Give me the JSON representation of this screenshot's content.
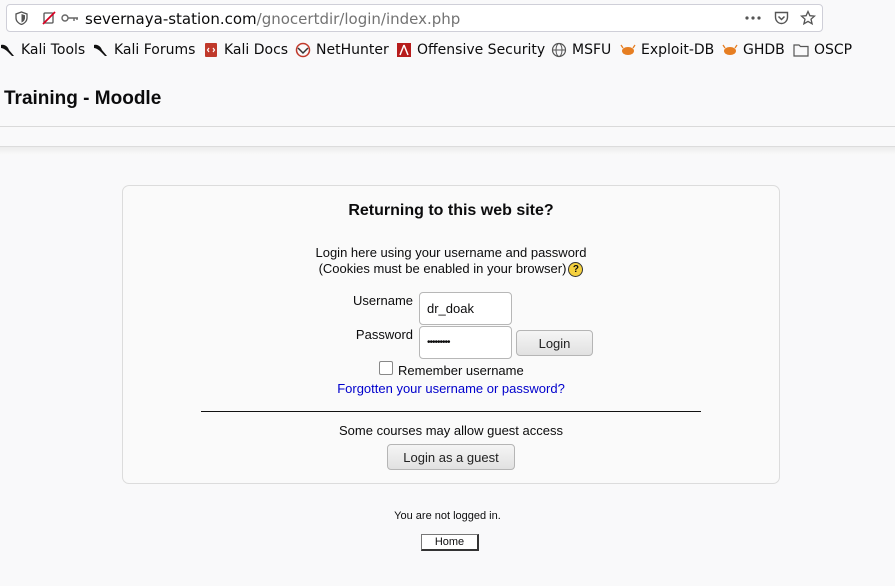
{
  "browser": {
    "url_domain": "severnaya-station.com",
    "url_path": "/gnocertdir/login/index.php"
  },
  "bookmarks": [
    {
      "label": "Kali Tools",
      "icon": "kali-dragon-icon"
    },
    {
      "label": "Kali Forums",
      "icon": "kali-dragon-icon"
    },
    {
      "label": "Kali Docs",
      "icon": "docs-book-icon"
    },
    {
      "label": "NetHunter",
      "icon": "nethunter-icon"
    },
    {
      "label": "Offensive Security",
      "icon": "offsec-icon"
    },
    {
      "label": "MSFU",
      "icon": "globe-icon"
    },
    {
      "label": "Exploit-DB",
      "icon": "exploitdb-bug-icon"
    },
    {
      "label": "GHDB",
      "icon": "exploitdb-bug-icon"
    },
    {
      "label": "OSCP",
      "icon": "folder-icon"
    }
  ],
  "page": {
    "site_title": "Training - Moodle",
    "login_box": {
      "title": "Returning to this web site?",
      "intro_line1": "Login here using your username and password",
      "intro_line2": "(Cookies must be enabled in your browser)",
      "help_glyph": "?",
      "username_label": "Username",
      "username_value": "dr_doak",
      "password_label": "Password",
      "password_value": "•••••••••",
      "login_button": "Login",
      "remember_label": "Remember username",
      "remember_checked": false,
      "forgot_link": "Forgotten your username or password?",
      "guest_text": "Some courses may allow guest access",
      "guest_button": "Login as a guest"
    },
    "footer": {
      "status": "You are not logged in.",
      "home_button": "Home"
    }
  }
}
